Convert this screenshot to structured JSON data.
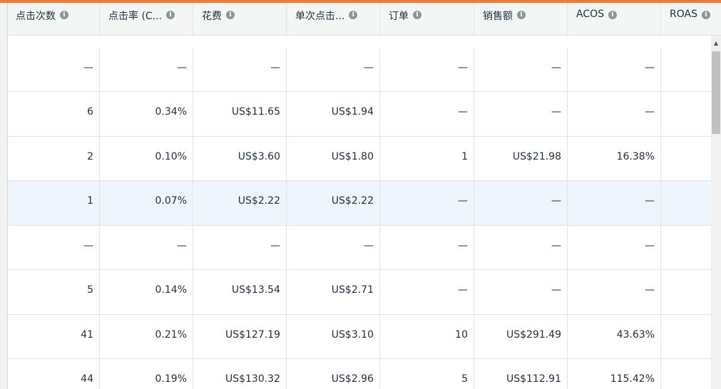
{
  "table": {
    "headers": [
      {
        "label": "点击次数"
      },
      {
        "label": "点击率 (C..."
      },
      {
        "label": "花费"
      },
      {
        "label": "单次点击..."
      },
      {
        "label": "订单"
      },
      {
        "label": "销售额"
      },
      {
        "label": "ACOS"
      },
      {
        "label": "ROAS"
      }
    ],
    "rows": [
      {
        "highlighted": false,
        "cells": [
          "—",
          "—",
          "—",
          "—",
          "—",
          "—",
          "—",
          ""
        ]
      },
      {
        "highlighted": false,
        "cells": [
          "6",
          "0.34%",
          "US$11.65",
          "US$1.94",
          "—",
          "—",
          "—",
          ""
        ]
      },
      {
        "highlighted": false,
        "cells": [
          "2",
          "0.10%",
          "US$3.60",
          "US$1.80",
          "1",
          "US$21.98",
          "16.38%",
          ""
        ]
      },
      {
        "highlighted": true,
        "cells": [
          "1",
          "0.07%",
          "US$2.22",
          "US$2.22",
          "—",
          "—",
          "—",
          ""
        ]
      },
      {
        "highlighted": false,
        "cells": [
          "—",
          "—",
          "—",
          "—",
          "—",
          "—",
          "—",
          ""
        ]
      },
      {
        "highlighted": false,
        "cells": [
          "5",
          "0.14%",
          "US$13.54",
          "US$2.71",
          "—",
          "—",
          "—",
          ""
        ]
      },
      {
        "highlighted": false,
        "cells": [
          "41",
          "0.21%",
          "US$127.19",
          "US$3.10",
          "10",
          "US$291.49",
          "43.63%",
          ""
        ]
      },
      {
        "highlighted": false,
        "cells": [
          "44",
          "0.19%",
          "US$130.32",
          "US$2.96",
          "5",
          "US$112.91",
          "115.42%",
          ""
        ]
      }
    ]
  },
  "icons": {
    "info": "info-icon",
    "scroll_up": "chevron-up-icon"
  },
  "colors": {
    "accent": "#ec7a3a",
    "highlight_row": "#eef5fd",
    "header_bg": "#f4f6f6"
  }
}
